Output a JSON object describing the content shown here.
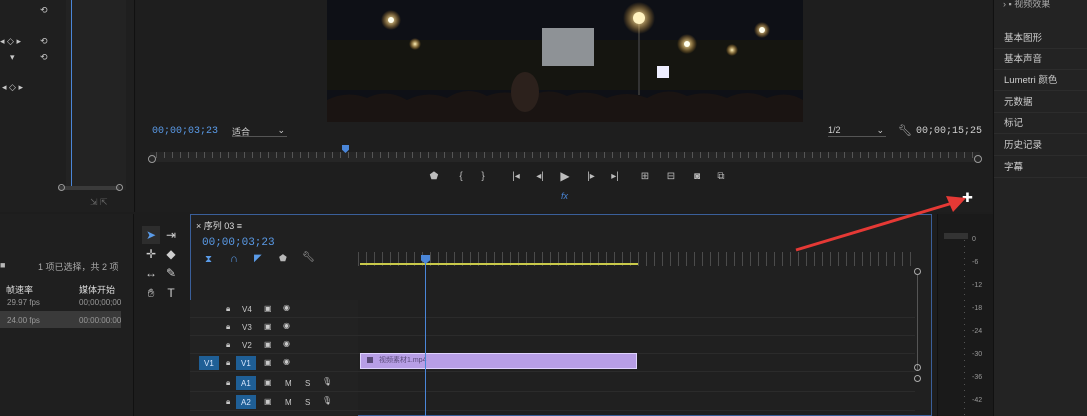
{
  "effect_controls": {
    "rows": [
      {
        "label": "",
        "icon": "reset-icon"
      },
      {
        "label": "◂ ◇ ▸",
        "icon": "reset-icon"
      },
      {
        "label": "▾",
        "icon": "reset-icon"
      },
      {
        "label": "◂ ◇ ▸",
        "icon": ""
      }
    ]
  },
  "program_monitor": {
    "timecode_current": "00;00;03;23",
    "zoom": "适合",
    "resolution": "1/2",
    "timecode_total": "00;00;15;25",
    "fx_label": "fx",
    "transport": [
      "marker-icon",
      "in-point-icon",
      "out-point-icon",
      "go-to-in-icon",
      "step-back-icon",
      "play-icon",
      "step-forward-icon",
      "go-to-out-icon",
      "lift-icon",
      "extract-icon",
      "export-frame-icon",
      "comparison-view-icon"
    ]
  },
  "right_panel": {
    "header": "视频效果",
    "items": [
      "基本图形",
      "基本声音",
      "Lumetri 颜色",
      "元数据",
      "标记",
      "历史记录",
      "字幕"
    ]
  },
  "project": {
    "selection_info": "1 项已选择，共 2 项",
    "col_framerate": "帧速率",
    "col_media_start": "媒体开始",
    "rows": [
      {
        "fps": "29.97 fps",
        "start": "00;00;00;00"
      },
      {
        "fps": "24.00 fps",
        "start": "00:00:00:00"
      }
    ]
  },
  "timeline": {
    "tab_label": "序列 03",
    "timecode": "00;00;03;23",
    "tracks": [
      {
        "name": "V4",
        "type": "video"
      },
      {
        "name": "V3",
        "type": "video"
      },
      {
        "name": "V2",
        "type": "video"
      },
      {
        "name": "V1",
        "type": "video",
        "source": "V1"
      },
      {
        "name": "A1",
        "type": "audio",
        "source": "A1"
      },
      {
        "name": "A2",
        "type": "audio",
        "source": "A2"
      }
    ],
    "clip_name": "视频素材1.mp4"
  },
  "audio_meter": {
    "scale": [
      "0",
      "-6",
      "-12",
      "-18",
      "-24",
      "-30",
      "-36",
      "-42"
    ]
  },
  "colors": {
    "accent": "#4a86d8",
    "clip": "#b79ee6",
    "workbar": "#c9c94a",
    "annotation_arrow": "#e53935"
  }
}
